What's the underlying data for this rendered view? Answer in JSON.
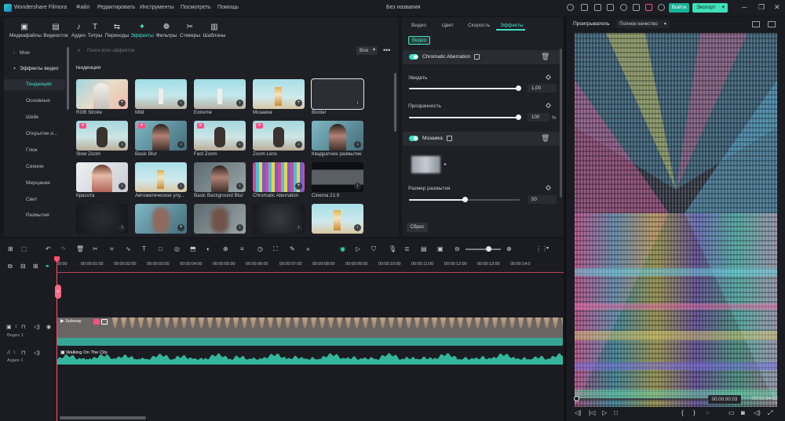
{
  "titlebar": {
    "app_name": "Wondershare Filmora",
    "menus": [
      "Файл",
      "Редактировать",
      "Инструменты",
      "Посмотреть",
      "Помощь"
    ],
    "document_title": "Без названия",
    "login_label": "Войти",
    "export_label": "Экспорт"
  },
  "toolbar": {
    "items": [
      {
        "label": "Медиафайлы",
        "icon": "media-icon"
      },
      {
        "label": "Видеосток",
        "icon": "stock-icon"
      },
      {
        "label": "Аудио",
        "icon": "audio-icon"
      },
      {
        "label": "Титры",
        "icon": "titles-icon"
      },
      {
        "label": "Переходы",
        "icon": "transitions-icon"
      },
      {
        "label": "Эффекты",
        "icon": "effects-icon"
      },
      {
        "label": "Фильтры",
        "icon": "filters-icon"
      },
      {
        "label": "Стикеры",
        "icon": "stickers-icon"
      },
      {
        "label": "Шаблоны",
        "icon": "templates-icon"
      }
    ],
    "active": "Эффекты"
  },
  "sidebar": {
    "items": [
      "Мои",
      "Эффекты видео",
      "Тенденция",
      "Основные",
      "Шейк",
      "Открытие и...",
      "Глюк",
      "Сияние",
      "Мерцание",
      "Свет",
      "Размытие"
    ]
  },
  "search": {
    "placeholder": "Поиск всех эффектов",
    "filter_label": "Все"
  },
  "section_title": "тенденция",
  "effects": [
    {
      "label": "RGB Stroke",
      "badge": "add"
    },
    {
      "label": "Mild",
      "badge": "download"
    },
    {
      "label": "Extreme",
      "badge": "download"
    },
    {
      "label": "Мозаика",
      "badge": "add"
    },
    {
      "label": "Border",
      "badge": "download"
    },
    {
      "label": "Slow Zoom",
      "badge": "download",
      "heart": true
    },
    {
      "label": "Basic Blur",
      "badge": "download",
      "heart": true
    },
    {
      "label": "Fast Zoom",
      "badge": "download",
      "heart": true
    },
    {
      "label": "Zoom Lens",
      "badge": "download",
      "heart": true
    },
    {
      "label": "Квадратное размытие",
      "badge": "download"
    },
    {
      "label": "Красота",
      "badge": "download"
    },
    {
      "label": "Автоматическое улу...",
      "badge": "download"
    },
    {
      "label": "Basic Background Blur",
      "badge": "download"
    },
    {
      "label": "Chromatic Aberration",
      "badge": "add"
    },
    {
      "label": "Cinema 21:9",
      "badge": "download"
    },
    {
      "label": "",
      "badge": "download"
    },
    {
      "label": "",
      "badge": "add"
    },
    {
      "label": "",
      "badge": "download"
    },
    {
      "label": "",
      "badge": "download"
    },
    {
      "label": "",
      "badge": "download"
    }
  ],
  "properties": {
    "tabs": [
      "Видео",
      "Цвет",
      "Скорость",
      "Эффекты"
    ],
    "active_tab": "Эффекты",
    "chip": "Видео",
    "effect1": {
      "name": "Chromatic Aberration",
      "params": [
        {
          "label": "Увидеть",
          "value": "1,00",
          "unit": "",
          "level": 1.0
        },
        {
          "label": "Прозрачность",
          "value": "100",
          "unit": "%",
          "level": 1.0
        }
      ]
    },
    "effect2": {
      "name": "Мозаика",
      "params": [
        {
          "label": "Размер размытия",
          "value": "50",
          "unit": "",
          "level": 0.5
        }
      ]
    },
    "reset_label": "Сброс"
  },
  "player": {
    "header": "Проигрыватель",
    "quality": "Полное качество",
    "current_time": "00:00:00:03",
    "separator": "/",
    "total_time": "00:01:04:52"
  },
  "timeline": {
    "ruler": [
      "00:00",
      "00:00:01:00",
      "00:00:02:00",
      "00:00:03:00",
      "00:00:04:00",
      "00:00:05:00",
      "00:00:06:00",
      "00:00:07:00",
      "00:00:08:00",
      "00:00:09:00",
      "00:00:10:00",
      "00:00:11:00",
      "00:00:12:00",
      "00:00:13:00",
      "00:00:14:0"
    ],
    "video_track_label": "Видео 1",
    "audio_track_label": "Аудио 1",
    "video_track_number": "1",
    "audio_track_number": "1",
    "video_clip_title": "Subway",
    "audio_clip_title": "Walking On The City"
  },
  "colors": {
    "accent": "#3ee0c5",
    "playhead": "#ff4f6d",
    "video_clip": "#2f9e8e",
    "audio_wave": "#34b59c"
  }
}
